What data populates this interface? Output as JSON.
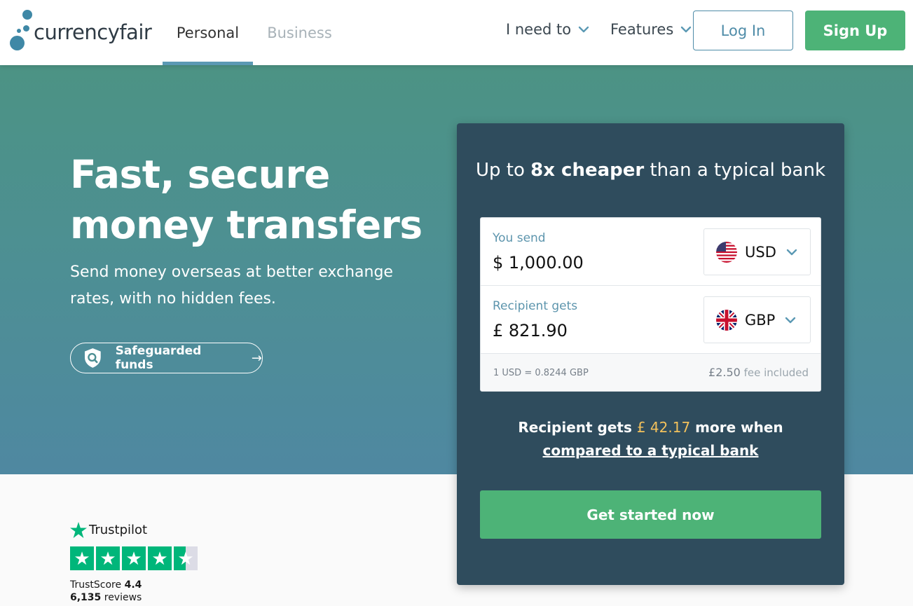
{
  "header": {
    "logo_text": "currencyfair",
    "tabs": [
      {
        "label": "Personal",
        "active": true
      },
      {
        "label": "Business",
        "active": false
      }
    ],
    "menus": [
      {
        "label": "I need to"
      },
      {
        "label": "Features"
      }
    ],
    "login_label": "Log In",
    "signup_label": "Sign Up"
  },
  "hero": {
    "title": "Fast, secure money transfers",
    "subtitle": "Send money overseas at better exchange rates, with no hidden fees.",
    "safeguard_label": "Safeguarded funds",
    "safeguard_arrow": "→"
  },
  "trustpilot": {
    "brand": "Trustpilot",
    "score_label": "TrustScore",
    "score": "4.4",
    "reviews_count": "6,135",
    "reviews_label": "reviews",
    "rating": 4.5,
    "max": 5
  },
  "calculator": {
    "heading_pre": "Up to ",
    "heading_bold": "8x cheaper",
    "heading_post": " than a typical bank",
    "send_label": "You send",
    "send_amount": "$ 1,000.00",
    "send_currency": "USD",
    "receive_label": "Recipient gets",
    "receive_amount": "£ 821.90",
    "receive_currency": "GBP",
    "rate": "1 USD = 0.8244 GBP",
    "fee_amount": "£2.50",
    "fee_text": "fee included",
    "savings_pre": "Recipient gets ",
    "savings_amount": "£ 42.17",
    "savings_mid": " more when ",
    "savings_link": "compared to a typical bank",
    "cta_label": "Get started now"
  },
  "colors": {
    "brand_blue": "#3f88a6",
    "green": "#4db377",
    "card_bg": "#2f4c5d",
    "highlight": "#f2c15c",
    "trustpilot_green": "#00b67a"
  }
}
